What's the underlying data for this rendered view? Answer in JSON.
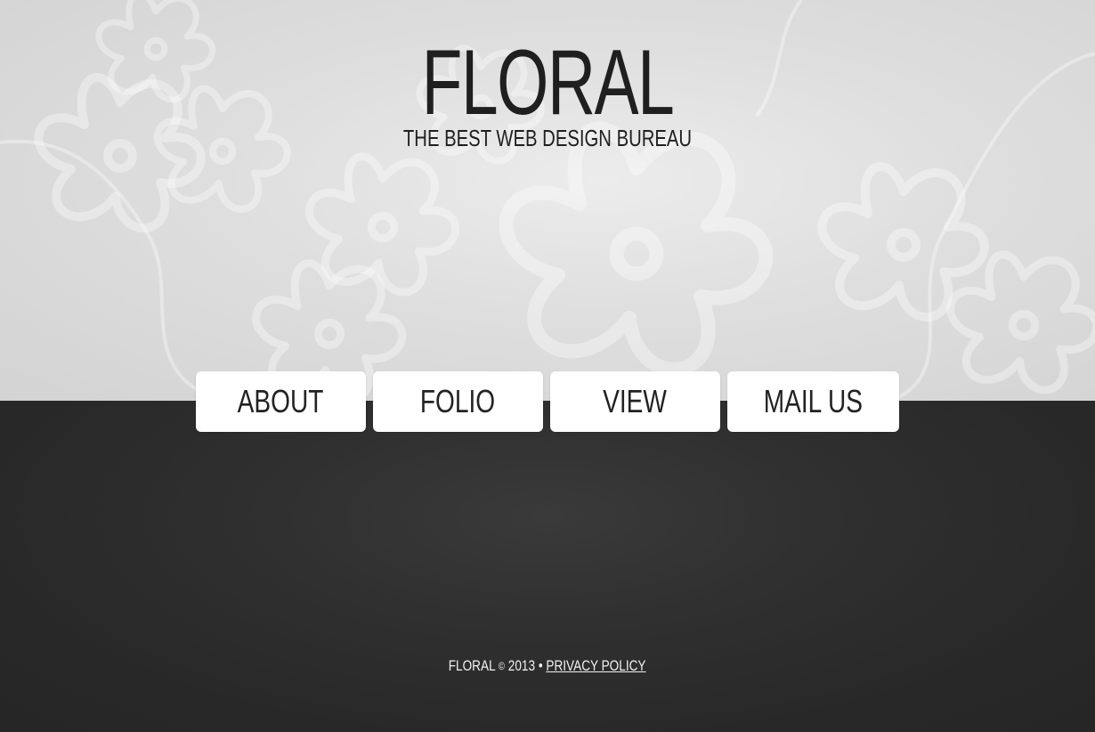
{
  "header": {
    "logo": "FLORAL",
    "tagline": "THE BEST WEB DESIGN BUREAU"
  },
  "nav": {
    "items": [
      {
        "label": "ABOUT"
      },
      {
        "label": "FOLIO"
      },
      {
        "label": "VIEW"
      },
      {
        "label": "MAIL US"
      }
    ]
  },
  "footer": {
    "brand": "FLORAL",
    "copyright_symbol": "©",
    "year": "2013",
    "separator": "•",
    "privacy_link": "PRIVACY POLICY"
  },
  "colors": {
    "top_background": "#dcdcdc",
    "bottom_background": "#2b2b2b",
    "text_dark": "#1f1f1f",
    "button_bg": "#ffffff",
    "footer_text": "#f2f2f2"
  }
}
